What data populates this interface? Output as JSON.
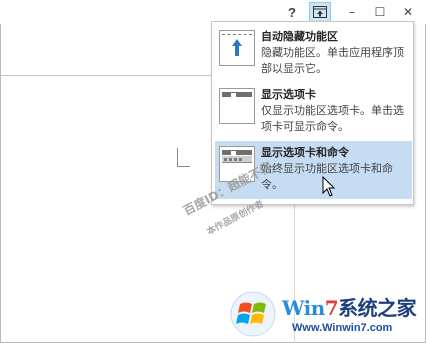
{
  "title_bar": {
    "help_label": "?",
    "minimize_label": "–",
    "maximize_label": "☐",
    "close_label": "✕",
    "ribbon_options_icon": "ribbon-display-options-icon"
  },
  "menu": {
    "items": [
      {
        "title": "自动隐藏功能区",
        "description": "隐藏功能区。单击应用程序顶部以显示它。",
        "icon": "auto-hide-ribbon-icon",
        "highlighted": false
      },
      {
        "title": "显示选项卡",
        "description": "仅显示功能区选项卡。单击选项卡可显示命令。",
        "icon": "show-tabs-icon",
        "highlighted": false
      },
      {
        "title": "显示选项卡和命令",
        "description": "始终显示功能区选项卡和命令。",
        "icon": "show-tabs-commands-icon",
        "highlighted": true
      }
    ]
  },
  "watermark": {
    "line1": "百度ID：超能不仔",
    "line2": "本作品原创作者"
  },
  "logo": {
    "win": "Win",
    "seven": "7",
    "cn": "系统之家",
    "url": "Www.Winwin7.com"
  },
  "colors": {
    "highlight": "#c5dcf2",
    "accent": "#2b79c2",
    "logo_blue": "#2c8bd6"
  }
}
